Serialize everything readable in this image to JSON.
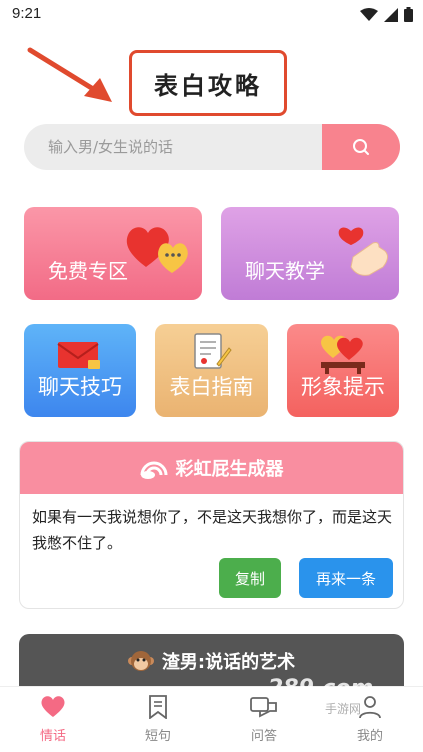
{
  "status_bar": {
    "time": "9:21"
  },
  "header": {
    "title": "表白攻略"
  },
  "search": {
    "placeholder": "输入男/女生说的话"
  },
  "categories": [
    {
      "label": "免费专区",
      "icon": "hearts-chat-icon"
    },
    {
      "label": "聊天教学",
      "icon": "finger-heart-icon"
    },
    {
      "label": "聊天技巧",
      "icon": "envelope-icon"
    },
    {
      "label": "表白指南",
      "icon": "document-pen-icon"
    },
    {
      "label": "形象提示",
      "icon": "heart-gift-icon"
    }
  ],
  "generator": {
    "title": "彩虹屁生成器",
    "text": "如果有一天我说想你了，不是这天我想你了，而是这天我憋不住了。",
    "copy_label": "复制",
    "again_label": "再来一条"
  },
  "zha_nan": {
    "title": "渣男:说话的艺术"
  },
  "watermark": {
    "brand": "289.com",
    "sub": "手游网"
  },
  "tabbar": {
    "items": [
      {
        "label": "情话",
        "icon": "heart-icon",
        "active": true
      },
      {
        "label": "短句",
        "icon": "bookmark-icon",
        "active": false
      },
      {
        "label": "问答",
        "icon": "chat-bubbles-icon",
        "active": false
      },
      {
        "label": "我的",
        "icon": "person-icon",
        "active": false
      }
    ]
  },
  "colors": {
    "accent": "#f46a84",
    "arrow": "#e04a2e",
    "copy_button": "#4cae4c",
    "again_button": "#2a93ec"
  }
}
